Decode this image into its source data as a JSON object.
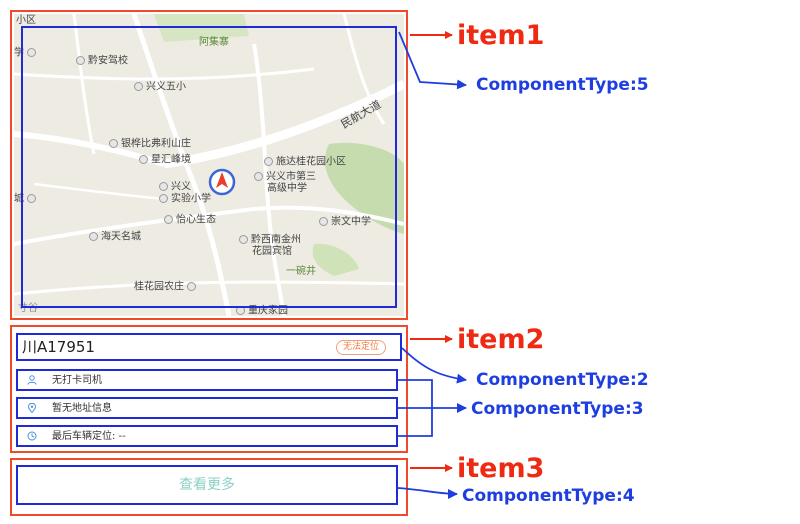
{
  "items": {
    "item1": "item1",
    "item2": "item2",
    "item3": "item3"
  },
  "component_types": {
    "ct5": "ComponentType:5",
    "ct2": "ComponentType:2",
    "ct3": "ComponentType:3",
    "ct4": "ComponentType:4"
  },
  "map": {
    "labels": {
      "xiaoqu": "小区",
      "axiao": "学",
      "qianan": "黔安驾校",
      "ajizhai": "阿集寨",
      "xingyiwuxiao": "兴义五小",
      "minhang": "民航大道",
      "yinhua": "银桦比弗利山庄",
      "xinghui": "星汇峰境",
      "shida": "施达桂花园小区",
      "xingyiA": "兴义",
      "shiyan": "实验小学",
      "xingyi3a": "兴义市第三",
      "xingyi3b": "高级中学",
      "cheng": "城",
      "yixin": "怡心生态",
      "xiaowen": "崇文中学",
      "haitian": "海天名城",
      "qianxi1": "黔西南金州",
      "qianxi2": "花园宾馆",
      "yiwanjing": "一碗井",
      "guihua": "桂花园农庄",
      "yuanyuan": "重庆家园",
      "bottom1": "寸谷"
    }
  },
  "vehicle": {
    "plate": "川A17951",
    "status_badge": "无法定位",
    "driver": "无打卡司机",
    "address": "暂无地址信息",
    "last_location": "最后车辆定位: --"
  },
  "button": {
    "more": "查看更多"
  },
  "colors": {
    "item_red": "#f04a2a",
    "component_blue": "#1f2bd6",
    "arrow_red": "#ee2a12",
    "arrow_blue": "#1f3ee0"
  }
}
